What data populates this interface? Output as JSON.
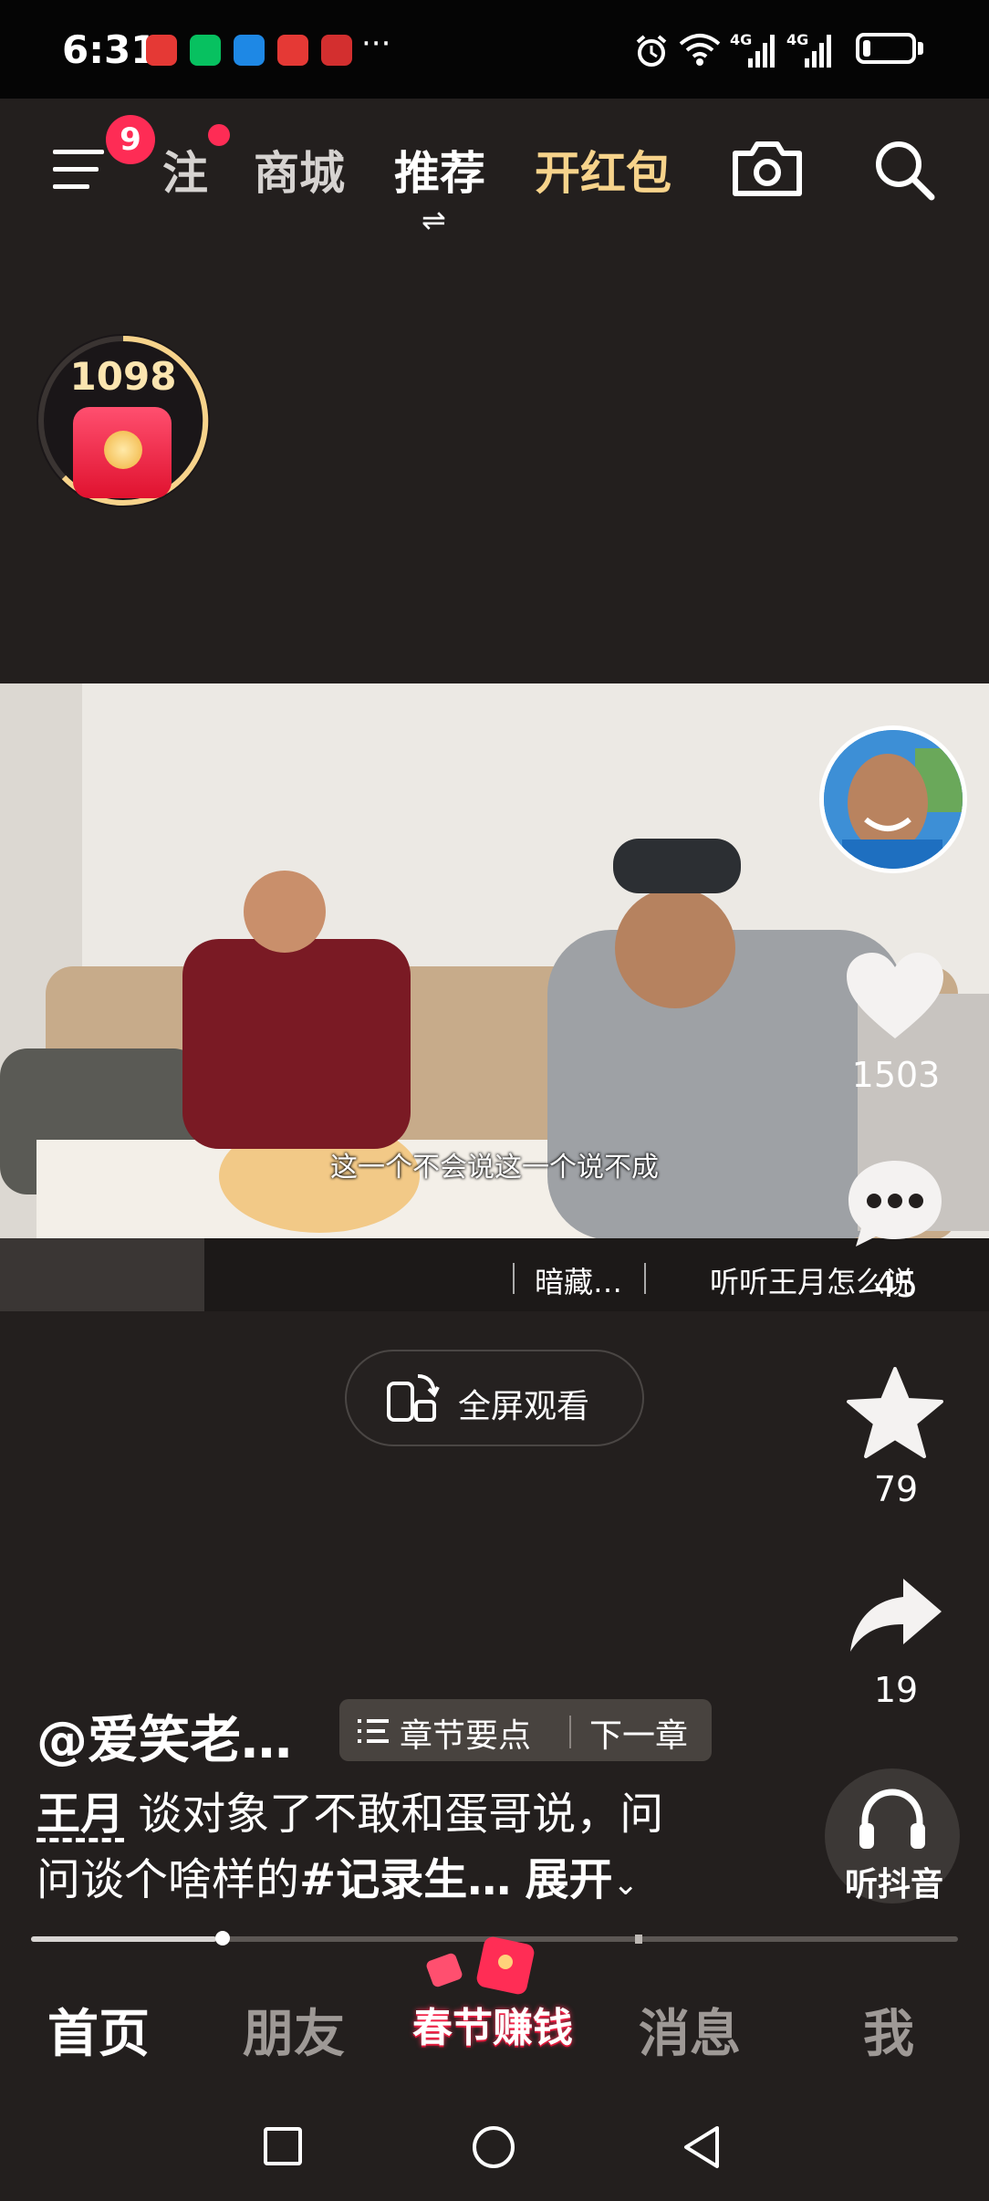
{
  "status_bar": {
    "time": "6:31",
    "more": "···",
    "network_1": "4G",
    "network_2": "4G",
    "icons": [
      "alarm-icon",
      "wifi-icon",
      "signal-icon",
      "signal-icon",
      "battery-icon"
    ],
    "battery_percent": 15
  },
  "top_nav": {
    "badge_count": "9",
    "tabs": [
      {
        "label": "注"
      },
      {
        "label": "商城"
      },
      {
        "label": "推荐"
      },
      {
        "label": "开红包"
      }
    ],
    "selected_tab": "推荐",
    "accent_color": "#f7d38b"
  },
  "reward": {
    "count": "1098"
  },
  "video": {
    "subtitle": "这一个不会说这一个说不成",
    "strip_item_1": "暗藏…",
    "strip_item_2": "听听王月怎么说"
  },
  "actions": {
    "like_count": "1503",
    "comment_count": "45",
    "favorite_count": "79",
    "share_count": "19",
    "listen_label": "听抖音"
  },
  "fullscreen": {
    "label": "全屏观看"
  },
  "caption": {
    "author": "@爱笑老…",
    "chapter_points": "章节要点",
    "chapter_next": "下一章",
    "tag_name": "王月",
    "line1_rest": " 谈对象了不敢和蛋哥说，问",
    "line2_text": "问谈个啥样的",
    "hashtag": "#记录生…",
    "expand": "展开"
  },
  "progress": {
    "fraction": 0.2
  },
  "bottom_nav": {
    "home": "首页",
    "friends": "朋友",
    "promo": "春节赚钱",
    "messages": "消息",
    "me": "我"
  },
  "colors": {
    "background": "#231f1e",
    "badge": "#fe2c55",
    "gold": "#f7d38b"
  }
}
